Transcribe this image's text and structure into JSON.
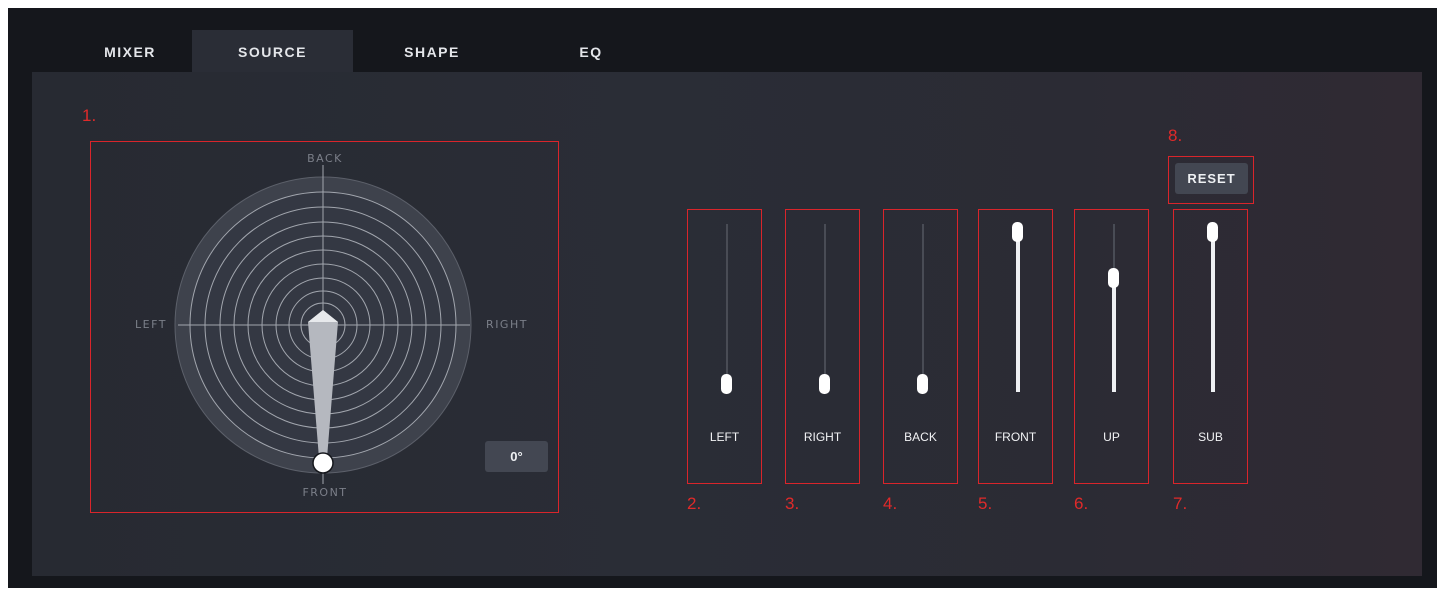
{
  "tabs": [
    {
      "label": "MIXER",
      "active": false
    },
    {
      "label": "SOURCE",
      "active": true
    },
    {
      "label": "SHAPE",
      "active": false
    },
    {
      "label": "EQ",
      "active": false
    }
  ],
  "panner": {
    "directions": {
      "back": "BACK",
      "front": "FRONT",
      "left": "LEFT",
      "right": "RIGHT"
    },
    "angle_readout": "0°",
    "angle_deg": 0
  },
  "sliders": [
    {
      "label": "LEFT",
      "level": 0.0
    },
    {
      "label": "RIGHT",
      "level": 0.0
    },
    {
      "label": "BACK",
      "level": 0.0
    },
    {
      "label": "FRONT",
      "level": 1.0
    },
    {
      "label": "UP",
      "level": 0.7
    },
    {
      "label": "SUB",
      "level": 1.0
    }
  ],
  "reset_label": "RESET",
  "callouts": [
    "1.",
    "2.",
    "3.",
    "4.",
    "5.",
    "6.",
    "7.",
    "8."
  ],
  "colors": {
    "accent_red": "#d9252b",
    "background": "#2a2d36",
    "button": "#434752"
  }
}
